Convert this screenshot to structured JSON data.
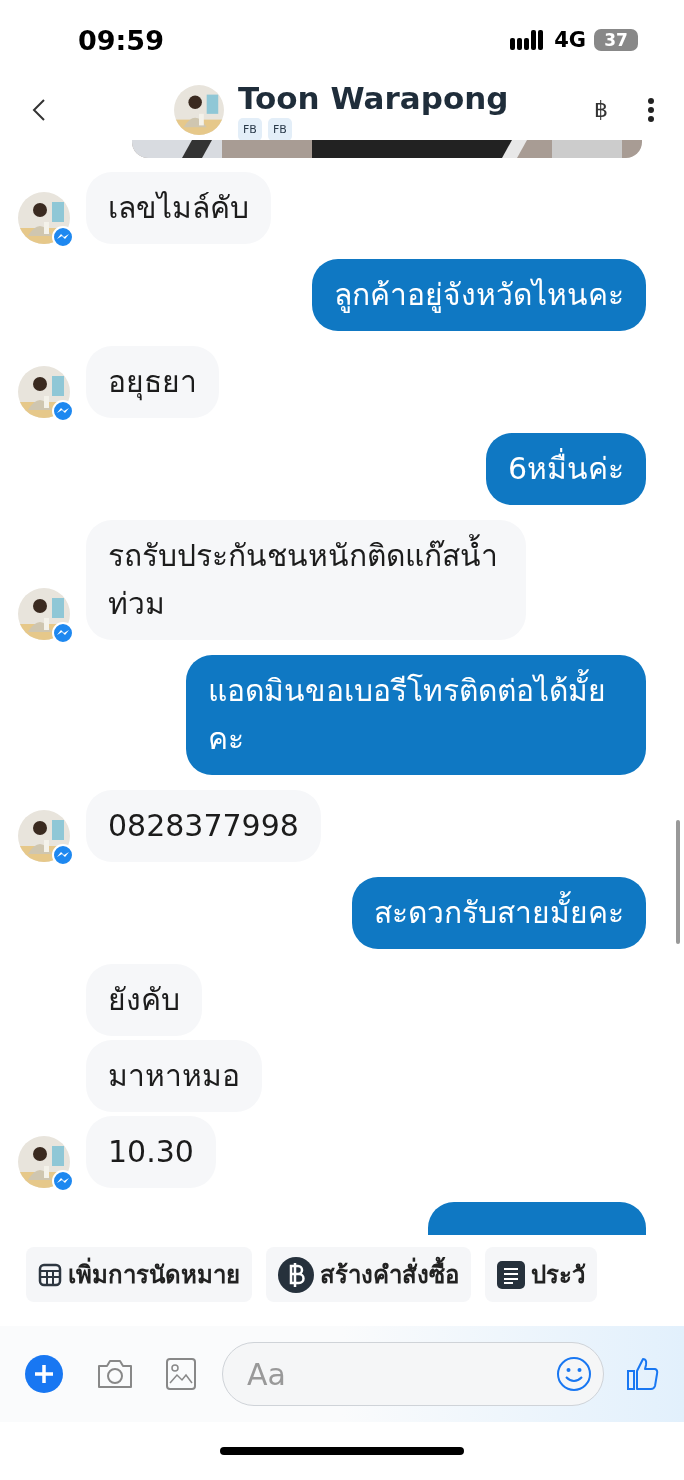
{
  "status_bar": {
    "time": "09:59",
    "network": "4G",
    "battery": "37"
  },
  "header": {
    "name": "Toon Warapong",
    "tags": [
      "FB",
      "FB"
    ],
    "currency_button": "฿"
  },
  "messages": [
    {
      "kind": "incoming",
      "text": "เลขไมล์คับ",
      "show_avatar": true
    },
    {
      "kind": "outgoing",
      "text": "ลูกค้าอยู่จังหวัดไหนคะ"
    },
    {
      "kind": "incoming",
      "text": "อยุธยา",
      "show_avatar": true
    },
    {
      "kind": "outgoing",
      "text": "6หมื่นค่ะ"
    },
    {
      "kind": "incoming",
      "text": "รถรับประกันชนหนักติดแก๊สน้ำท่วม",
      "show_avatar": true
    },
    {
      "kind": "outgoing",
      "text": "แอดมินขอเบอรีโทรติดต่อได้มั้ยคะ"
    },
    {
      "kind": "incoming",
      "text": "0828377998",
      "show_avatar": true
    },
    {
      "kind": "outgoing",
      "text": "สะดวกรับสายมั้ยคะ"
    },
    {
      "kind": "incoming",
      "text": "ยังคับ",
      "show_avatar": false
    },
    {
      "kind": "incoming",
      "text": "มาหาหมอ",
      "show_avatar": false
    },
    {
      "kind": "incoming",
      "text": "10.30",
      "show_avatar": true
    }
  ],
  "quick_actions": [
    {
      "kind": "calendar",
      "label": "เพิ่มการนัดหมาย"
    },
    {
      "kind": "baht",
      "label": "สร้างคำสั่งซื้อ"
    },
    {
      "kind": "document",
      "label": "ประวั"
    }
  ],
  "composer": {
    "placeholder": "Aa"
  }
}
